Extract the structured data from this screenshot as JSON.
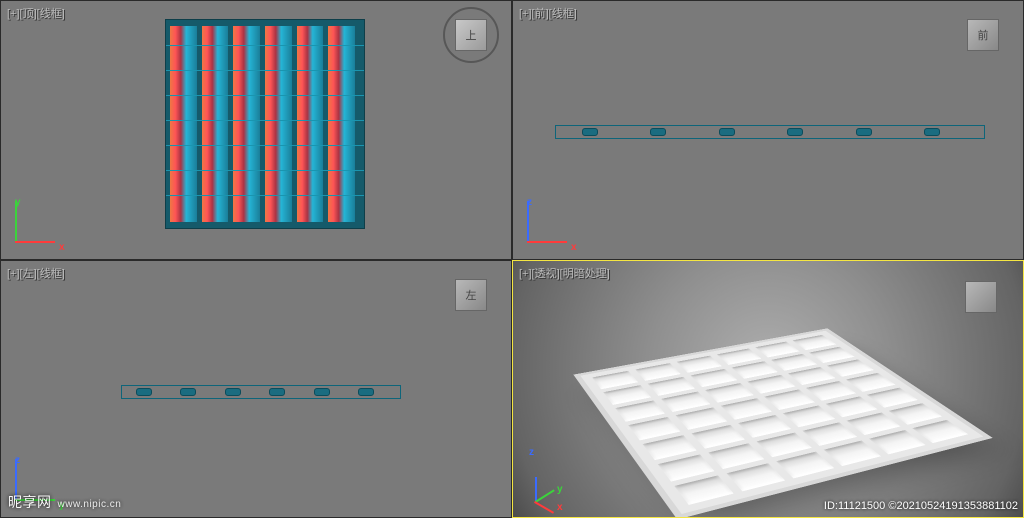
{
  "watermark": {
    "site": "昵享网",
    "url": "www.nipic.cn"
  },
  "meta_id": "ID:11121500 ©20210524191353881102",
  "viewports": {
    "top": {
      "label": "[+][顶][线框]",
      "cube": "上",
      "axes": {
        "v": "y",
        "vcol": "#3bd43b",
        "h": "x",
        "hcol": "#ff3b3b"
      }
    },
    "front": {
      "label": "[+][前][线框]",
      "cube": "前",
      "axes": {
        "v": "z",
        "vcol": "#3a6bff",
        "h": "x",
        "hcol": "#ff3b3b"
      }
    },
    "left": {
      "label": "[+][左][线框]",
      "cube": "左",
      "axes": {
        "v": "z",
        "vcol": "#3a6bff",
        "h": "y",
        "hcol": "#3bd43b"
      }
    },
    "persp": {
      "label": "[+][透视][明暗处理]",
      "cube": "",
      "axes": {}
    }
  },
  "axis3d": {
    "z": {
      "col": "#3a6bff"
    },
    "y": {
      "col": "#3bd43b"
    },
    "x": {
      "col": "#ff3b3b"
    }
  },
  "grille": {
    "cols": 6,
    "rows": 7
  },
  "wire_slots": 6
}
